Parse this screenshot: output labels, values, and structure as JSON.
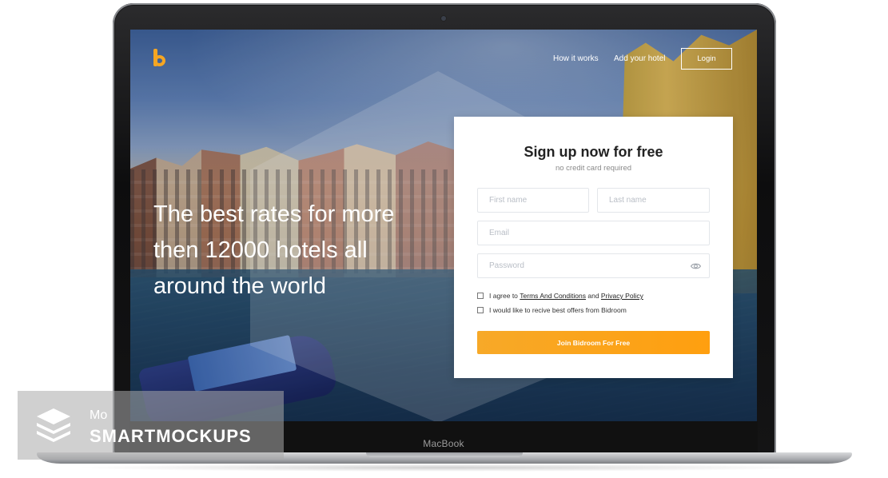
{
  "device": {
    "model_label": "MacBook"
  },
  "header": {
    "logo_letter": "b",
    "nav": {
      "how_it_works": "How it works",
      "add_hotel": "Add your hotel"
    },
    "login_label": "Login"
  },
  "hero": {
    "headline": "The best rates for more then 12000 hotels all around the world"
  },
  "signup": {
    "title": "Sign up now for free",
    "subtitle": "no credit card required",
    "first_name_placeholder": "First name",
    "last_name_placeholder": "Last name",
    "email_placeholder": "Email",
    "password_placeholder": "Password",
    "agree_prefix": "I agree to",
    "terms_link": "Terms And Conditions",
    "and_text": "and",
    "privacy_link": "Privacy Policy",
    "offers_label": "I would like to recive best offers from Bidroom",
    "join_button": "Join Bidroom For Free"
  },
  "watermark": {
    "line1": "Mo",
    "line2": "SMARTMOCKUPS"
  },
  "colors": {
    "accent": "#f5a623",
    "button": "#ff9f0f"
  }
}
